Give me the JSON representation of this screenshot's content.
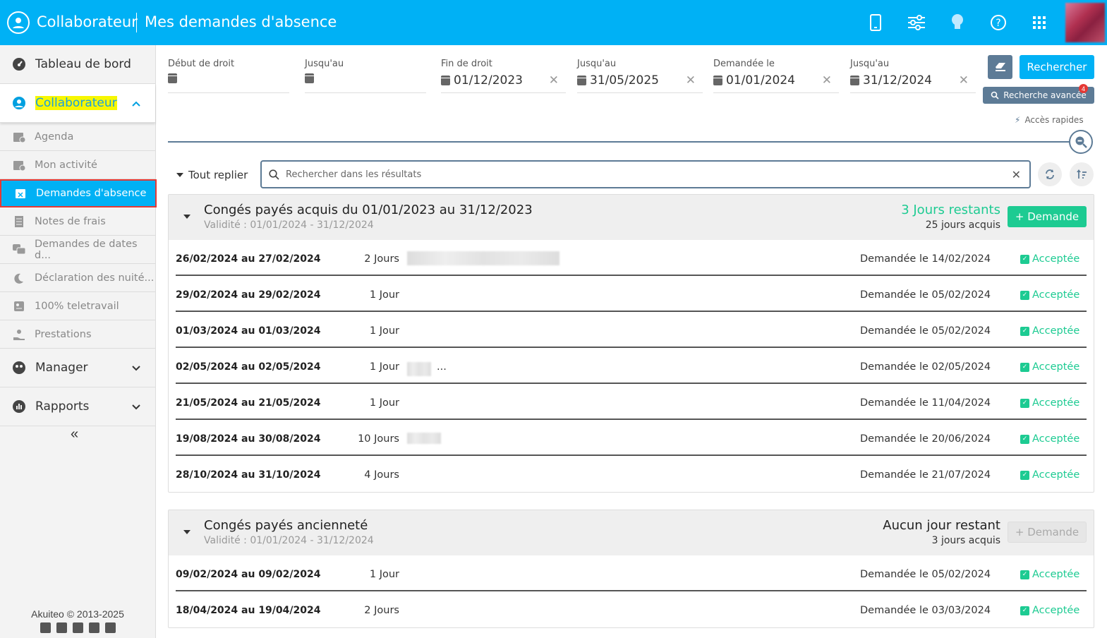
{
  "header": {
    "app_title": "Collaborateur",
    "page_title": "Mes demandes d'absence"
  },
  "sidebar": {
    "dashboard": "Tableau de bord",
    "collaborateur": "Collaborateur",
    "items": [
      "Agenda",
      "Mon activité",
      "Demandes d'absence",
      "Notes de frais",
      "Demandes de dates d...",
      "Déclaration des nuité...",
      "100% teletravail",
      "Prestations"
    ],
    "manager": "Manager",
    "rapports": "Rapports",
    "collapse": "«",
    "footer": "Akuiteo © 2013-2025"
  },
  "filters": [
    {
      "label": "Début de droit",
      "value": ""
    },
    {
      "label": "Jusqu'au",
      "value": ""
    },
    {
      "label": "Fin de droit",
      "value": "01/12/2023"
    },
    {
      "label": "Jusqu'au",
      "value": "31/05/2025"
    },
    {
      "label": "Demandée le",
      "value": "01/01/2024"
    },
    {
      "label": "Jusqu'au",
      "value": "31/12/2024"
    }
  ],
  "actions": {
    "search": "Rechercher",
    "advanced": "Recherche avancée",
    "badge": "4",
    "quick": "Accès rapides"
  },
  "results": {
    "toggle": "Tout replier",
    "search_placeholder": "Rechercher dans les résultats"
  },
  "groups": [
    {
      "title": "Congés payés acquis du 01/01/2023 au 31/12/2023",
      "validity": "Validité : 01/01/2024 - 31/12/2024",
      "remaining": "3 Jours restants",
      "acquired": "25 jours acquis",
      "button": "+ Demande",
      "rows": [
        {
          "dates": "26/02/2024 au 27/02/2024",
          "days": "2 Jours",
          "requested": "Demandée le 14/02/2024",
          "status": "Acceptée"
        },
        {
          "dates": "29/02/2024 au 29/02/2024",
          "days": "1 Jour",
          "requested": "Demandée le 05/02/2024",
          "status": "Acceptée"
        },
        {
          "dates": "01/03/2024 au 01/03/2024",
          "days": "1 Jour",
          "requested": "Demandée le 05/02/2024",
          "status": "Acceptée"
        },
        {
          "dates": "02/05/2024 au 02/05/2024",
          "days": "1 Jour",
          "requested": "Demandée le 02/05/2024",
          "status": "Acceptée",
          "comment": "..."
        },
        {
          "dates": "21/05/2024 au 21/05/2024",
          "days": "1 Jour",
          "requested": "Demandée le 11/04/2024",
          "status": "Acceptée"
        },
        {
          "dates": "19/08/2024 au 30/08/2024",
          "days": "10 Jours",
          "requested": "Demandée le 20/06/2024",
          "status": "Acceptée"
        },
        {
          "dates": "28/10/2024 au 31/10/2024",
          "days": "4 Jours",
          "requested": "Demandée le 21/07/2024",
          "status": "Acceptée"
        }
      ]
    },
    {
      "title": "Congés payés ancienneté",
      "validity": "Validité : 01/01/2024 - 31/12/2024",
      "remaining": "Aucun jour restant",
      "acquired": "3 jours acquis",
      "button": "+ Demande",
      "rows": [
        {
          "dates": "09/02/2024 au 09/02/2024",
          "days": "1 Jour",
          "requested": "Demandée le 05/02/2024",
          "status": "Acceptée"
        },
        {
          "dates": "18/04/2024 au 19/04/2024",
          "days": "2 Jours",
          "requested": "Demandée le 03/03/2024",
          "status": "Acceptée"
        }
      ]
    }
  ],
  "colors": {
    "primary": "#00b1f5",
    "accent": "#1dcb92",
    "slate": "#5d7b96",
    "disabled": "#cfcfcf"
  }
}
